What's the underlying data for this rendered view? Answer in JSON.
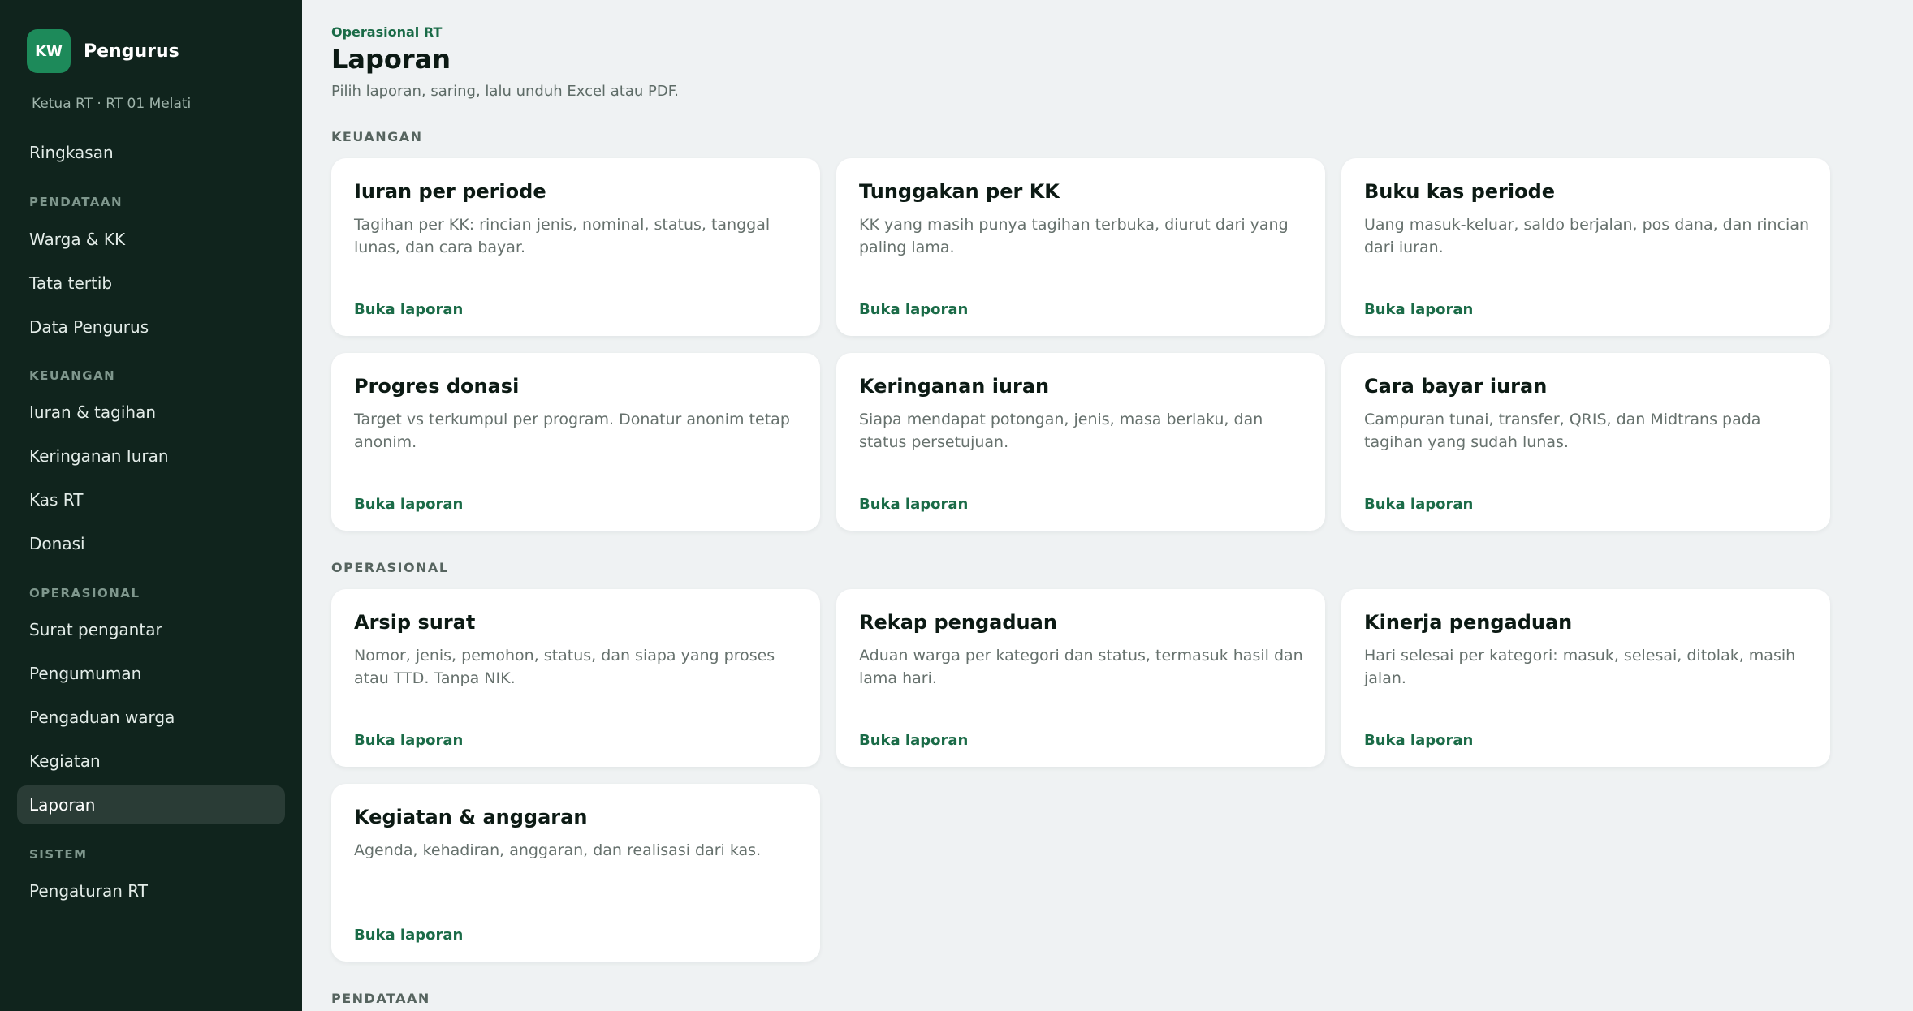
{
  "sidebar": {
    "avatar": "KW",
    "brand": "Pengurus",
    "role": "Ketua RT · RT 01 Melati",
    "summary": "Ringkasan",
    "sections": [
      {
        "title": "PENDATAAN",
        "items": [
          "Warga & KK",
          "Tata tertib",
          "Data Pengurus"
        ]
      },
      {
        "title": "KEUANGAN",
        "items": [
          "Iuran & tagihan",
          "Keringanan Iuran",
          "Kas RT",
          "Donasi"
        ]
      },
      {
        "title": "OPERASIONAL",
        "items": [
          "Surat pengantar",
          "Pengumuman",
          "Pengaduan warga",
          "Kegiatan",
          "Laporan"
        ]
      },
      {
        "title": "SISTEM",
        "items": [
          "Pengaturan RT"
        ]
      }
    ],
    "active": "Laporan"
  },
  "header": {
    "eyebrow": "Operasional RT",
    "title": "Laporan",
    "subtitle": "Pilih laporan, saring, lalu unduh Excel atau PDF."
  },
  "sections": [
    {
      "title": "KEUANGAN",
      "cards": [
        {
          "title": "Iuran per periode",
          "desc": "Tagihan per KK: rincian jenis, nominal, status, tanggal lunas, dan cara bayar.",
          "link": "Buka laporan"
        },
        {
          "title": "Tunggakan per KK",
          "desc": "KK yang masih punya tagihan terbuka, diurut dari yang paling lama.",
          "link": "Buka laporan"
        },
        {
          "title": "Buku kas periode",
          "desc": "Uang masuk-keluar, saldo berjalan, pos dana, dan rincian dari iuran.",
          "link": "Buka laporan"
        },
        {
          "title": "Progres donasi",
          "desc": "Target vs terkumpul per program. Donatur anonim tetap anonim.",
          "link": "Buka laporan"
        },
        {
          "title": "Keringanan iuran",
          "desc": "Siapa mendapat potongan, jenis, masa berlaku, dan status persetujuan.",
          "link": "Buka laporan"
        },
        {
          "title": "Cara bayar iuran",
          "desc": "Campuran tunai, transfer, QRIS, dan Midtrans pada tagihan yang sudah lunas.",
          "link": "Buka laporan"
        }
      ]
    },
    {
      "title": "OPERASIONAL",
      "cards": [
        {
          "title": "Arsip surat",
          "desc": "Nomor, jenis, pemohon, status, dan siapa yang proses atau TTD. Tanpa NIK.",
          "link": "Buka laporan"
        },
        {
          "title": "Rekap pengaduan",
          "desc": "Aduan warga per kategori dan status, termasuk hasil dan lama hari.",
          "link": "Buka laporan"
        },
        {
          "title": "Kinerja pengaduan",
          "desc": "Hari selesai per kategori: masuk, selesai, ditolak, masih jalan.",
          "link": "Buka laporan"
        },
        {
          "title": "Kegiatan & anggaran",
          "desc": "Agenda, kehadiran, anggaran, dan realisasi dari kas.",
          "link": "Buka laporan"
        }
      ]
    },
    {
      "title": "PENDATAAN",
      "cards": []
    }
  ],
  "colors": {
    "sidebar": "#10241d",
    "accent": "#1a6b47",
    "avatar": "#1d8a5a",
    "background": "#eff2f3"
  }
}
